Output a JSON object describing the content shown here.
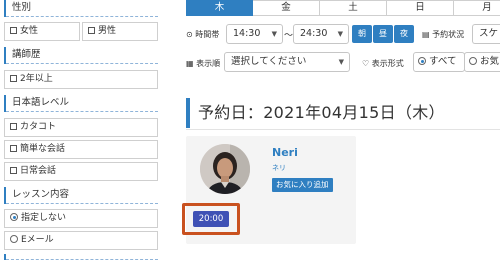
{
  "sidebar": {
    "sections": [
      {
        "title": "性別",
        "options": [
          "女性",
          "男性"
        ]
      },
      {
        "title": "講師歴",
        "options": [
          "2年以上"
        ]
      },
      {
        "title": "日本語レベル",
        "options": [
          "カタコト",
          "簡単な会話",
          "日常会話"
        ]
      },
      {
        "title": "レッスン内容",
        "options": [
          "指定しない",
          "Eメール"
        ]
      }
    ]
  },
  "days": [
    "木",
    "金",
    "土",
    "日",
    "月"
  ],
  "filters": {
    "time_label": "時間帯",
    "time_from": "14:30",
    "tilde": "～",
    "time_to": "24:30",
    "btn_morning": "朝",
    "btn_noon": "昼",
    "btn_night": "夜",
    "reserve_status_label": "予約状況",
    "reserve_status_value": "スケ",
    "display_order_label": "表示順",
    "display_order_placeholder": "選択してください",
    "display_format_label": "表示形式",
    "format_all": "すべて",
    "format_fav": "お気"
  },
  "schedule": {
    "date_heading": "予約日：2021年04月15日（木）",
    "teacher": {
      "name": "Neri",
      "kana": "ネリ",
      "fav_button": "お気に入り追加",
      "time_slot": "20:00"
    }
  },
  "colors": {
    "accent": "#2f7fc1",
    "slot_button": "#3f51b5",
    "highlight_frame": "#c9511f"
  }
}
